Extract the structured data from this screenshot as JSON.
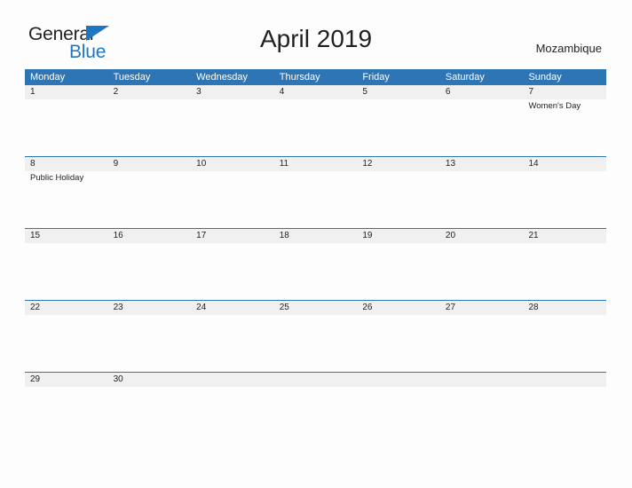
{
  "brand": {
    "name_part1": "General",
    "name_part2": "Blue",
    "flag_icon": "blue-triangle-flag",
    "color_dark": "#231f20",
    "color_blue": "#1f76c0"
  },
  "header": {
    "title": "April 2019",
    "region": "Mozambique"
  },
  "calendar": {
    "header_color": "#2e75b6",
    "band_color": "#f0f0f0",
    "weekdays": [
      "Monday",
      "Tuesday",
      "Wednesday",
      "Thursday",
      "Friday",
      "Saturday",
      "Sunday"
    ],
    "weeks": [
      {
        "days": [
          {
            "date": "1",
            "event": ""
          },
          {
            "date": "2",
            "event": ""
          },
          {
            "date": "3",
            "event": ""
          },
          {
            "date": "4",
            "event": ""
          },
          {
            "date": "5",
            "event": ""
          },
          {
            "date": "6",
            "event": ""
          },
          {
            "date": "7",
            "event": "Women's Day"
          }
        ]
      },
      {
        "days": [
          {
            "date": "8",
            "event": "Public Holiday"
          },
          {
            "date": "9",
            "event": ""
          },
          {
            "date": "10",
            "event": ""
          },
          {
            "date": "11",
            "event": ""
          },
          {
            "date": "12",
            "event": ""
          },
          {
            "date": "13",
            "event": ""
          },
          {
            "date": "14",
            "event": ""
          }
        ]
      },
      {
        "days": [
          {
            "date": "15",
            "event": ""
          },
          {
            "date": "16",
            "event": ""
          },
          {
            "date": "17",
            "event": ""
          },
          {
            "date": "18",
            "event": ""
          },
          {
            "date": "19",
            "event": ""
          },
          {
            "date": "20",
            "event": ""
          },
          {
            "date": "21",
            "event": ""
          }
        ]
      },
      {
        "days": [
          {
            "date": "22",
            "event": ""
          },
          {
            "date": "23",
            "event": ""
          },
          {
            "date": "24",
            "event": ""
          },
          {
            "date": "25",
            "event": ""
          },
          {
            "date": "26",
            "event": ""
          },
          {
            "date": "27",
            "event": ""
          },
          {
            "date": "28",
            "event": ""
          }
        ]
      },
      {
        "days": [
          {
            "date": "29",
            "event": ""
          },
          {
            "date": "30",
            "event": ""
          },
          {
            "date": "",
            "event": ""
          },
          {
            "date": "",
            "event": ""
          },
          {
            "date": "",
            "event": ""
          },
          {
            "date": "",
            "event": ""
          },
          {
            "date": "",
            "event": ""
          }
        ]
      }
    ]
  }
}
